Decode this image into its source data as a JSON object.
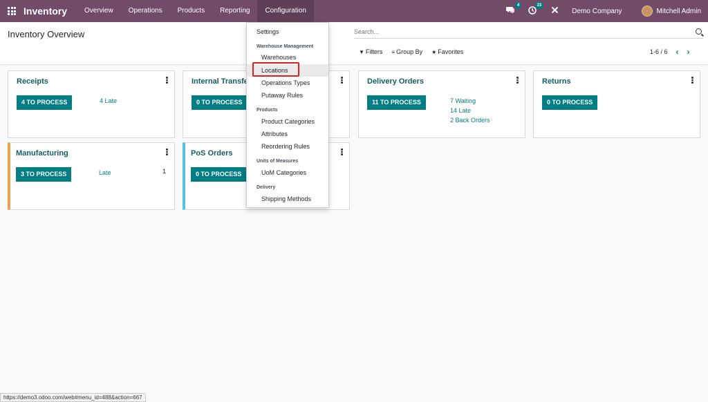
{
  "navbar": {
    "app_name": "Inventory",
    "menu": [
      "Overview",
      "Operations",
      "Products",
      "Reporting",
      "Configuration"
    ],
    "messages_count": "4",
    "activities_count": "23",
    "company": "Demo Company",
    "user": "Mitchell Admin",
    "accent_color": "#714b67"
  },
  "control_panel": {
    "title": "Inventory Overview",
    "search_placeholder": "Search...",
    "filters_label": "Filters",
    "group_by_label": "Group By",
    "favorites_label": "Favorites",
    "pager": "1-6 / 6"
  },
  "cards": [
    {
      "title": "Receipts",
      "button": "4 TO PROCESS",
      "stats": [
        "4 Late"
      ]
    },
    {
      "title": "Internal Transfers",
      "button": "0 TO PROCESS",
      "stats": []
    },
    {
      "title": "Delivery Orders",
      "button": "11 TO PROCESS",
      "stats": [
        "7 Waiting",
        "14 Late",
        "2 Back Orders"
      ]
    },
    {
      "title": "Returns",
      "button": "0 TO PROCESS",
      "stats": []
    },
    {
      "title": "Manufacturing",
      "button": "3 TO PROCESS",
      "stats": [
        "Late"
      ],
      "count": "1"
    },
    {
      "title": "PoS Orders",
      "button": "0 TO PROCESS",
      "stats": []
    }
  ],
  "dropdown": {
    "settings": "Settings",
    "wh_header": "Warehouse Management",
    "warehouses": "Warehouses",
    "locations": "Locations",
    "operation_types": "Operations Types",
    "putaway_rules": "Putaway Rules",
    "products_header": "Products",
    "product_categories": "Product Categories",
    "attributes": "Attributes",
    "reordering_rules": "Reordering Rules",
    "uom_header": "Units of Measures",
    "uom_categories": "UoM Categories",
    "delivery_header": "Delivery",
    "shipping_methods": "Shipping Methods"
  },
  "statusbar": {
    "url": "https://demo3.odoo.com/web#menu_id=488&action=667"
  }
}
